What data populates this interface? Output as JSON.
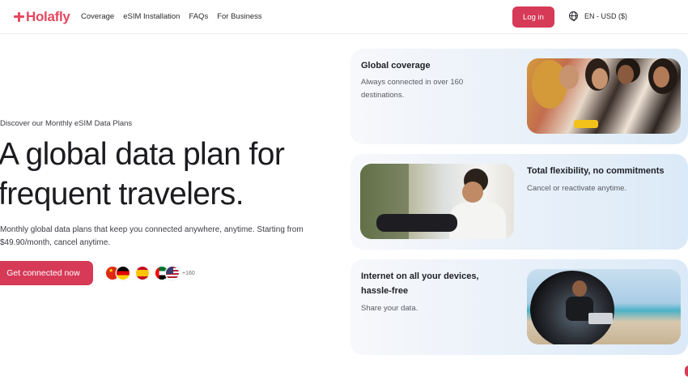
{
  "header": {
    "logo_text": "Holafly",
    "nav": [
      "Coverage",
      "eSIM Installation",
      "FAQs",
      "For Business"
    ],
    "login_label": "Log in",
    "locale_label": "EN - USD ($)"
  },
  "hero": {
    "eyebrow": "Discover our Monthly eSIM Data Plans",
    "headline": "A global data plan for frequent travelers.",
    "subtext": "Monthly global data plans that keep you connected anywhere, anytime. Starting from $49.90/month, cancel anytime.",
    "cta_label": "Get connected now",
    "flags_count": "+160"
  },
  "cards": [
    {
      "title": "Global coverage",
      "description": "Always connected in over 160 destinations."
    },
    {
      "title": "Total flexibility, no commitments",
      "description": "Cancel or reactivate anytime."
    },
    {
      "title": "Internet on all your devices, hassle-free",
      "description": "Share your data."
    }
  ],
  "colors": {
    "brand": "#e6475f",
    "button": "#d63a57"
  }
}
